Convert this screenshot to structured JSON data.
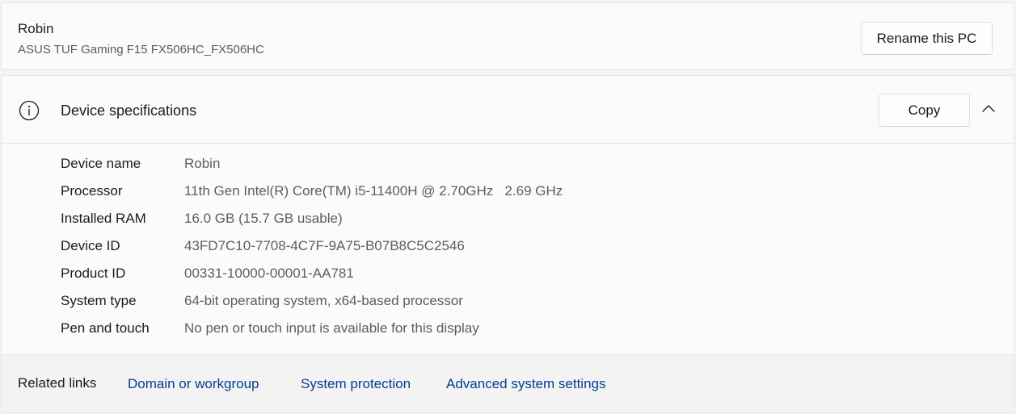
{
  "device": {
    "name": "Robin",
    "model": "ASUS TUF Gaming F15 FX506HC_FX506HC",
    "rename_label": "Rename this PC"
  },
  "specs": {
    "icon": "info-icon",
    "title": "Device specifications",
    "copy_label": "Copy",
    "expanded": true,
    "rows": [
      {
        "label": "Device name",
        "value": "Robin"
      },
      {
        "label": "Processor",
        "value": "11th Gen Intel(R) Core(TM) i5-11400H @ 2.70GHz   2.69 GHz"
      },
      {
        "label": "Installed RAM",
        "value": "16.0 GB (15.7 GB usable)"
      },
      {
        "label": "Device ID",
        "value": "43FD7C10-7708-4C7F-9A75-B07B8C5C2546"
      },
      {
        "label": "Product ID",
        "value": "00331-10000-00001-AA781"
      },
      {
        "label": "System type",
        "value": "64-bit operating system, x64-based processor"
      },
      {
        "label": "Pen and touch",
        "value": "No pen or touch input is available for this display"
      }
    ]
  },
  "related": {
    "title": "Related links",
    "links": [
      {
        "label": "Domain or workgroup"
      },
      {
        "label": "System protection"
      },
      {
        "label": "Advanced system settings"
      }
    ]
  },
  "colors": {
    "link": "#003e92",
    "secondary_text": "#5d5d5d",
    "card_bg": "#fbfbfb",
    "page_bg": "#f3f3f3"
  }
}
